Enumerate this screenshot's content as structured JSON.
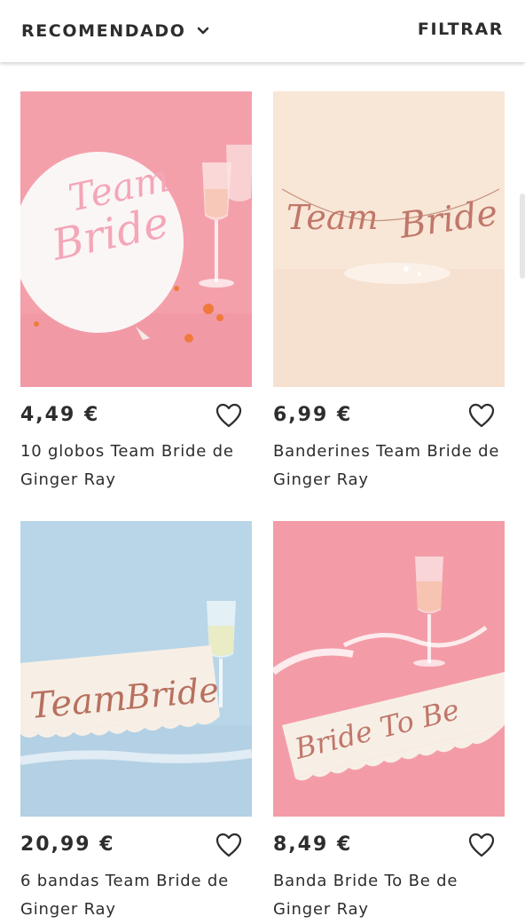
{
  "toolbar": {
    "sort_label": "RECOMENDADO",
    "filter_label": "FILTRAR"
  },
  "products": [
    {
      "price": "4,49 €",
      "title_line1": "10 globos Team Bride de",
      "title_line2": "Ginger Ray",
      "image_text": [
        "Team",
        "Bride"
      ],
      "background": "#f4a0ab"
    },
    {
      "price": "6,99 €",
      "title_line1": "Banderines Team Bride de",
      "title_line2": "Ginger Ray",
      "image_text": [
        "Team",
        "Bride"
      ],
      "background": "#f8e6d6"
    },
    {
      "price": "20,99 €",
      "title_line1": "6 bandas Team Bride de",
      "title_line2": "Ginger Ray",
      "image_text": [
        "Team Bride"
      ],
      "background": "#b9d6e8"
    },
    {
      "price": "8,49 €",
      "title_line1": "Banda Bride To Be de",
      "title_line2": "Ginger Ray",
      "image_text": [
        "Bride To Be"
      ],
      "background": "#f39ca7"
    }
  ],
  "icons": {
    "sort_chevron": "chevron-down-icon",
    "favorite": "heart-outline-icon"
  },
  "colors": {
    "text": "#2d2d2d",
    "rose_gold": "#c0776a"
  }
}
